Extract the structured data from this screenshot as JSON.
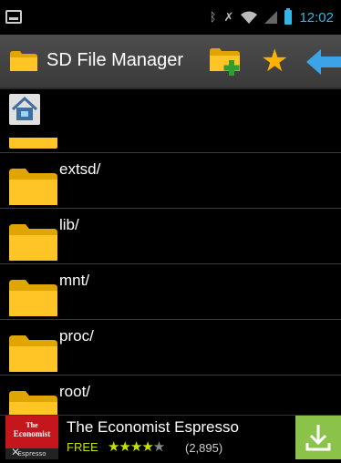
{
  "status_bar": {
    "time": "12:02",
    "icons": [
      "image-icon",
      "bluetooth-icon",
      "no-sim-icon",
      "wifi-icon",
      "signal-icon",
      "battery-icon"
    ]
  },
  "action_bar": {
    "title": "SD File Manager",
    "actions": [
      "new-folder-icon",
      "star-icon",
      "back-arrow-icon"
    ]
  },
  "file_list": [
    {
      "name": "extsd/"
    },
    {
      "name": "lib/"
    },
    {
      "name": "mnt/"
    },
    {
      "name": "proc/"
    },
    {
      "name": "root/"
    }
  ],
  "ad": {
    "logo_line1": "The",
    "logo_line2": "Economist",
    "logo_line3": "Espresso",
    "title": "The Economist Espresso",
    "price": "FREE",
    "rating": 4,
    "rating_count": "(2,895)"
  },
  "colors": {
    "accent": "#33b5e5",
    "folder": "#f5b800",
    "star": "#ffb300",
    "ad_green": "#8bc34a",
    "ad_red": "#c4161c"
  }
}
